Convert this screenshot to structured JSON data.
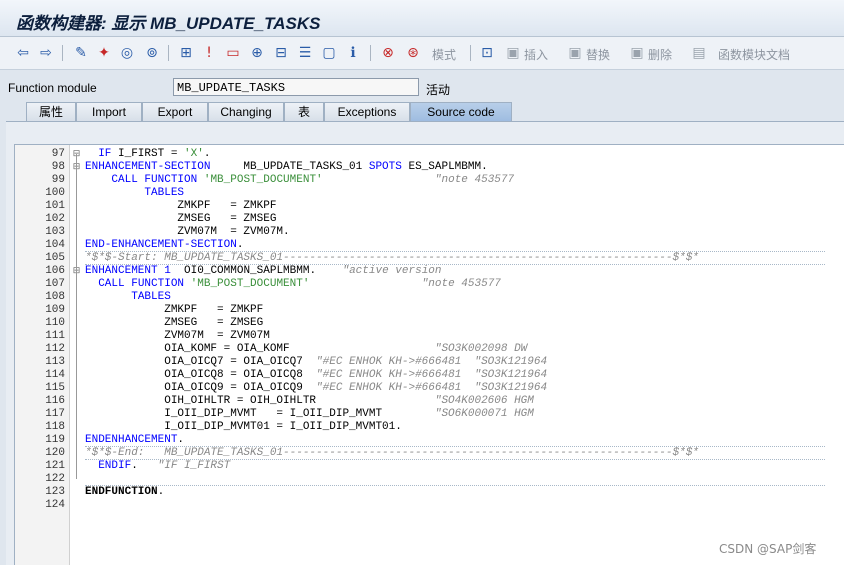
{
  "window": {
    "title": "函数构建器: 显示 MB_UPDATE_TASKS"
  },
  "toolbar": {
    "buttons": [
      {
        "name": "back-icon",
        "glyph": "⇦"
      },
      {
        "name": "forward-icon",
        "glyph": "⇨"
      },
      {
        "name": "edit-pencil-icon",
        "glyph": "✎"
      },
      {
        "name": "activate-icon",
        "glyph": "✦"
      },
      {
        "name": "check-icon",
        "glyph": "◎"
      },
      {
        "name": "hierarchy-icon",
        "glyph": "⊞"
      },
      {
        "name": "where-used-icon",
        "glyph": "⊥"
      },
      {
        "name": "display-object-list-icon",
        "glyph": "▭"
      },
      {
        "name": "navigate-icon",
        "glyph": "⊕"
      },
      {
        "name": "structure-icon",
        "glyph": "⊟"
      },
      {
        "name": "pattern-icon",
        "glyph": "☰"
      },
      {
        "name": "window-icon",
        "glyph": "▢"
      },
      {
        "name": "info-icon",
        "glyph": "ℹ"
      },
      {
        "name": "test-icon",
        "glyph": "⊗"
      },
      {
        "name": "debug-icon",
        "glyph": "⊛"
      }
    ],
    "mode_label": "模式",
    "insert_label": "插入",
    "replace_label": "替换",
    "delete_label": "删除",
    "docs_label": "函数模块文档"
  },
  "function_module": {
    "label": "Function module",
    "value": "MB_UPDATE_TASKS",
    "status": "活动"
  },
  "tabs": [
    "属性",
    "Import",
    "Export",
    "Changing",
    "表",
    "Exceptions",
    "Source code"
  ],
  "active_tab": "Source code",
  "code_lines": [
    {
      "n": "97",
      "text": "  IF I_FIRST = 'X'."
    },
    {
      "n": "98",
      "text": "ENHANCEMENT-SECTION     MB_UPDATE_TASKS_01 SPOTS ES_SAPLMBMM."
    },
    {
      "n": "99",
      "text": "    CALL FUNCTION 'MB_POST_DOCUMENT'                 \"note 453577"
    },
    {
      "n": "100",
      "text": "         TABLES"
    },
    {
      "n": "101",
      "text": "              ZMKPF   = ZMKPF"
    },
    {
      "n": "102",
      "text": "              ZMSEG   = ZMSEG"
    },
    {
      "n": "103",
      "text": "              ZVM07M  = ZVM07M."
    },
    {
      "n": "104",
      "text": "END-ENHANCEMENT-SECTION."
    },
    {
      "n": "105",
      "text": "*$*$-Start: MB_UPDATE_TASKS_01-----------------------------------------------------------$*$*"
    },
    {
      "n": "106",
      "text": "ENHANCEMENT 1  OI0_COMMON_SAPLMBMM.    \"active version"
    },
    {
      "n": "107",
      "text": "  CALL FUNCTION 'MB_POST_DOCUMENT'                 \"note 453577"
    },
    {
      "n": "108",
      "text": "       TABLES"
    },
    {
      "n": "109",
      "text": "            ZMKPF   = ZMKPF"
    },
    {
      "n": "110",
      "text": "            ZMSEG   = ZMSEG"
    },
    {
      "n": "111",
      "text": "            ZVM07M  = ZVM07M"
    },
    {
      "n": "112",
      "text": "            OIA_KOMF = OIA_KOMF                      \"SO3K002098 DW"
    },
    {
      "n": "113",
      "text": "            OIA_OICQ7 = OIA_OICQ7  \"#EC ENHOK KH->#666481  \"SO3K121964"
    },
    {
      "n": "114",
      "text": "            OIA_OICQ8 = OIA_OICQ8  \"#EC ENHOK KH->#666481  \"SO3K121964"
    },
    {
      "n": "115",
      "text": "            OIA_OICQ9 = OIA_OICQ9  \"#EC ENHOK KH->#666481  \"SO3K121964"
    },
    {
      "n": "116",
      "text": "            OIH_OIHLTR = OIH_OIHLTR                  \"SO4K002606 HGM"
    },
    {
      "n": "117",
      "text": "            I_OII_DIP_MVMT   = I_OII_DIP_MVMT        \"SO6K000071 HGM"
    },
    {
      "n": "118",
      "text": "            I_OII_DIP_MVMT01 = I_OII_DIP_MVMT01."
    },
    {
      "n": "119",
      "text": "ENDENHANCEMENT."
    },
    {
      "n": "120",
      "text": "*$*$-End:   MB_UPDATE_TASKS_01-----------------------------------------------------------$*$*"
    },
    {
      "n": "121",
      "text": "  ENDIF.   \"IF I_FIRST"
    },
    {
      "n": "122",
      "text": ""
    },
    {
      "n": "123",
      "text": "ENDFUNCTION."
    },
    {
      "n": "124",
      "text": ""
    }
  ],
  "watermark": "CSDN @SAP剑客",
  "colors": {
    "keyword": "#0000ff",
    "string": "#3a8f3a",
    "comment": "#888888"
  }
}
